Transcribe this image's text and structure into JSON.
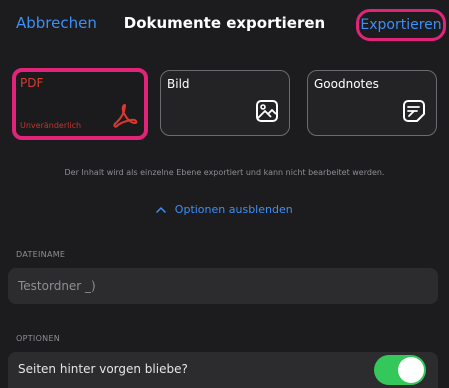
{
  "header": {
    "cancel_label": "Abbrechen",
    "title": "Dokumente exportieren",
    "export_label": "Exportieren"
  },
  "formats": [
    {
      "label": "PDF",
      "sublabel": "Unveränderlich",
      "icon": "pdf-acrobat-icon",
      "selected": true
    },
    {
      "label": "Bild",
      "icon": "image-icon",
      "selected": false
    },
    {
      "label": "Goodnotes",
      "icon": "goodnotes-document-icon",
      "selected": false
    }
  ],
  "info_text": "Der Inhalt wird als einzelne Ebene exportiert und kann nicht bearbeitet werden.",
  "options_toggle": {
    "icon": "chevron-up-icon",
    "label": "Optionen ausblenden"
  },
  "filename": {
    "section_label": "DATEINAME",
    "value": "Testordner _)"
  },
  "options": {
    "section_label": "OPTIONEN",
    "row_label": "Seiten hinter vorgen bliebe?",
    "toggle_on": true
  },
  "colors": {
    "accent": "#3b8ff6",
    "highlight": "#e0247a",
    "pdf_red": "#d83a32",
    "switch_on": "#34c759",
    "background": "#1c1c1e"
  }
}
